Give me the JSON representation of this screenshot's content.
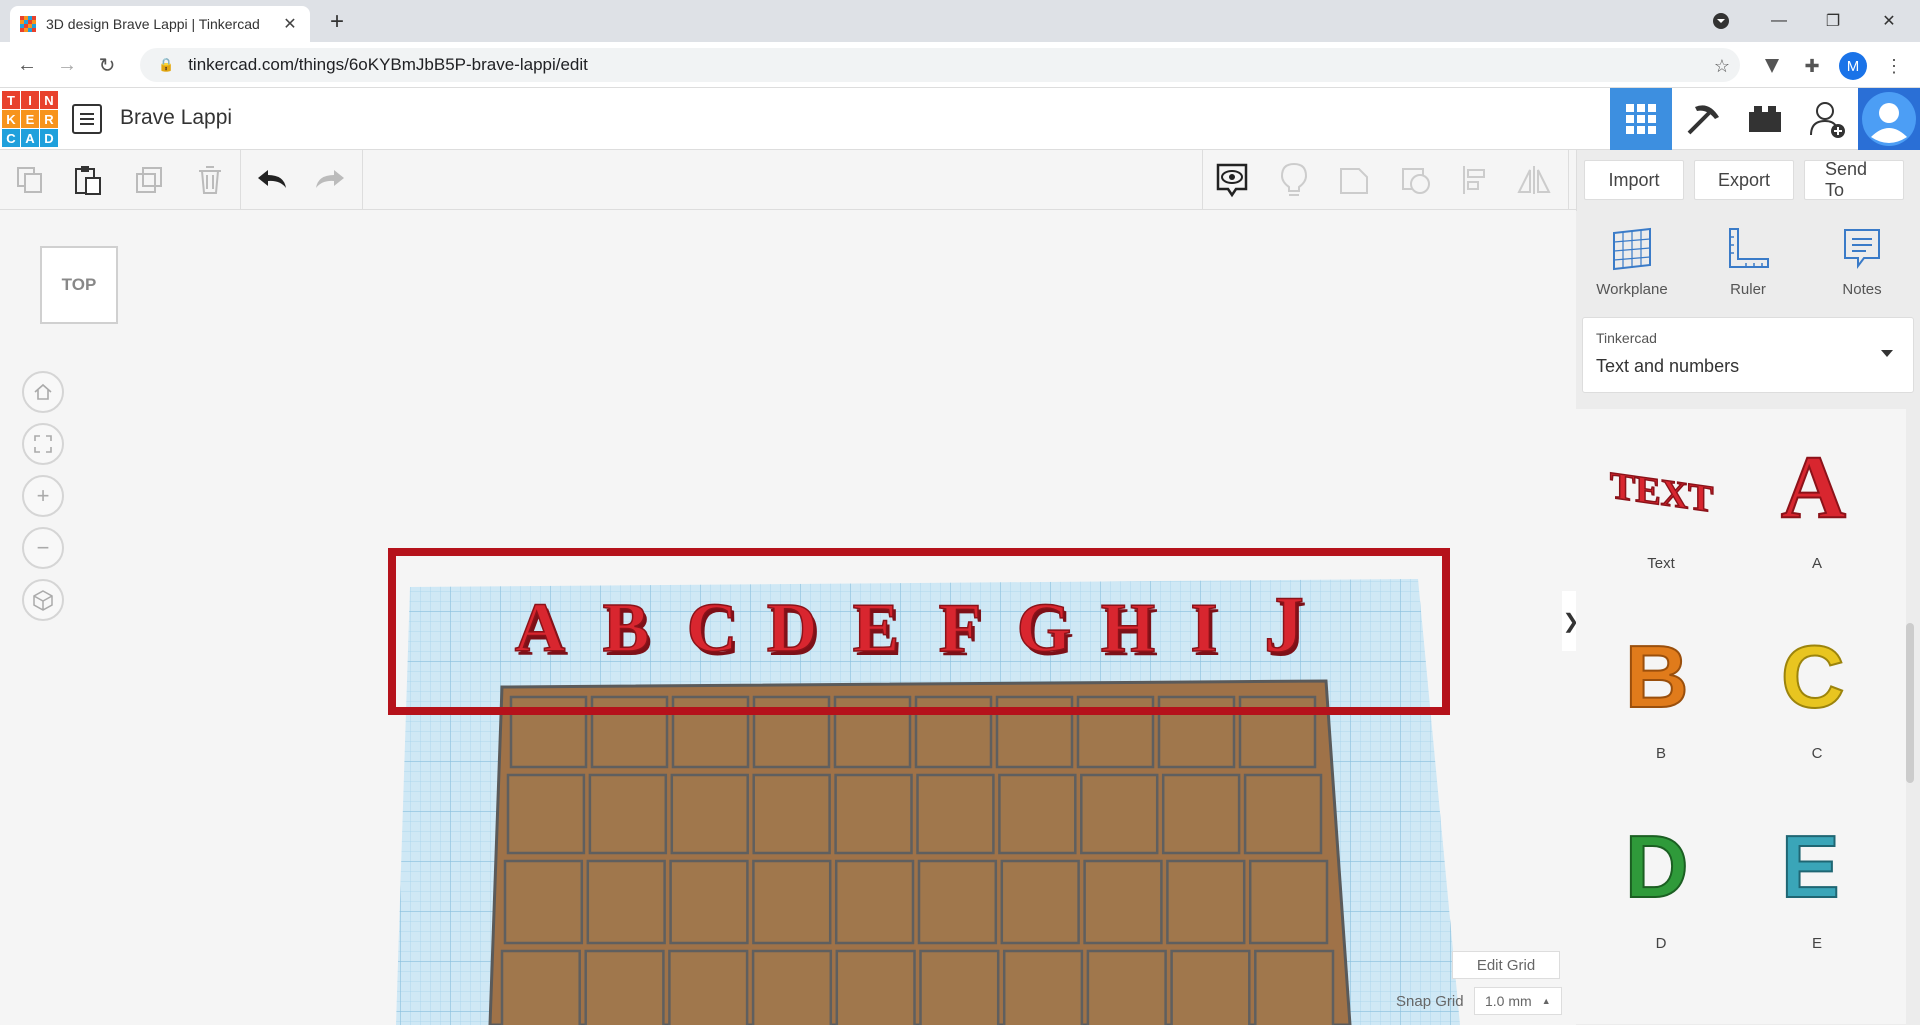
{
  "browser": {
    "tab_title": "3D design Brave Lappi | Tinkercad",
    "url": "tinkercad.com/things/6oKYBmJbB5P-brave-lappi/edit",
    "profile_initial": "M"
  },
  "app": {
    "logo_letters": [
      "T",
      "I",
      "N",
      "K",
      "E",
      "R",
      "C",
      "A",
      "D"
    ],
    "logo_colors": [
      "#e8412c",
      "#e8412c",
      "#e8412c",
      "#f7941d",
      "#f7941d",
      "#f7941d",
      "#1fa0dc",
      "#1fa0dc",
      "#1fa0dc"
    ],
    "project_name": "Brave Lappi"
  },
  "toolbar": {
    "import_label": "Import",
    "export_label": "Export",
    "send_to_label": "Send To"
  },
  "panel": {
    "workplane_label": "Workplane",
    "ruler_label": "Ruler",
    "notes_label": "Notes",
    "library": "Tinkercad",
    "category": "Text and numbers",
    "shapes": [
      {
        "label": "Text",
        "color": "#d8262f"
      },
      {
        "label": "A",
        "color": "#d8262f"
      },
      {
        "label": "B",
        "color": "#e07b1b"
      },
      {
        "label": "C",
        "color": "#e8c520"
      },
      {
        "label": "D",
        "color": "#2f9a3a"
      },
      {
        "label": "E",
        "color": "#3aa5b8"
      }
    ]
  },
  "canvas": {
    "view_label": "TOP",
    "letters": [
      "A",
      "B",
      "C",
      "D",
      "E",
      "F",
      "G",
      "H",
      "I",
      "J"
    ],
    "edit_grid_label": "Edit Grid",
    "snap_grid_label": "Snap Grid",
    "snap_grid_value": "1.0 mm",
    "accent": "#b5121b"
  }
}
